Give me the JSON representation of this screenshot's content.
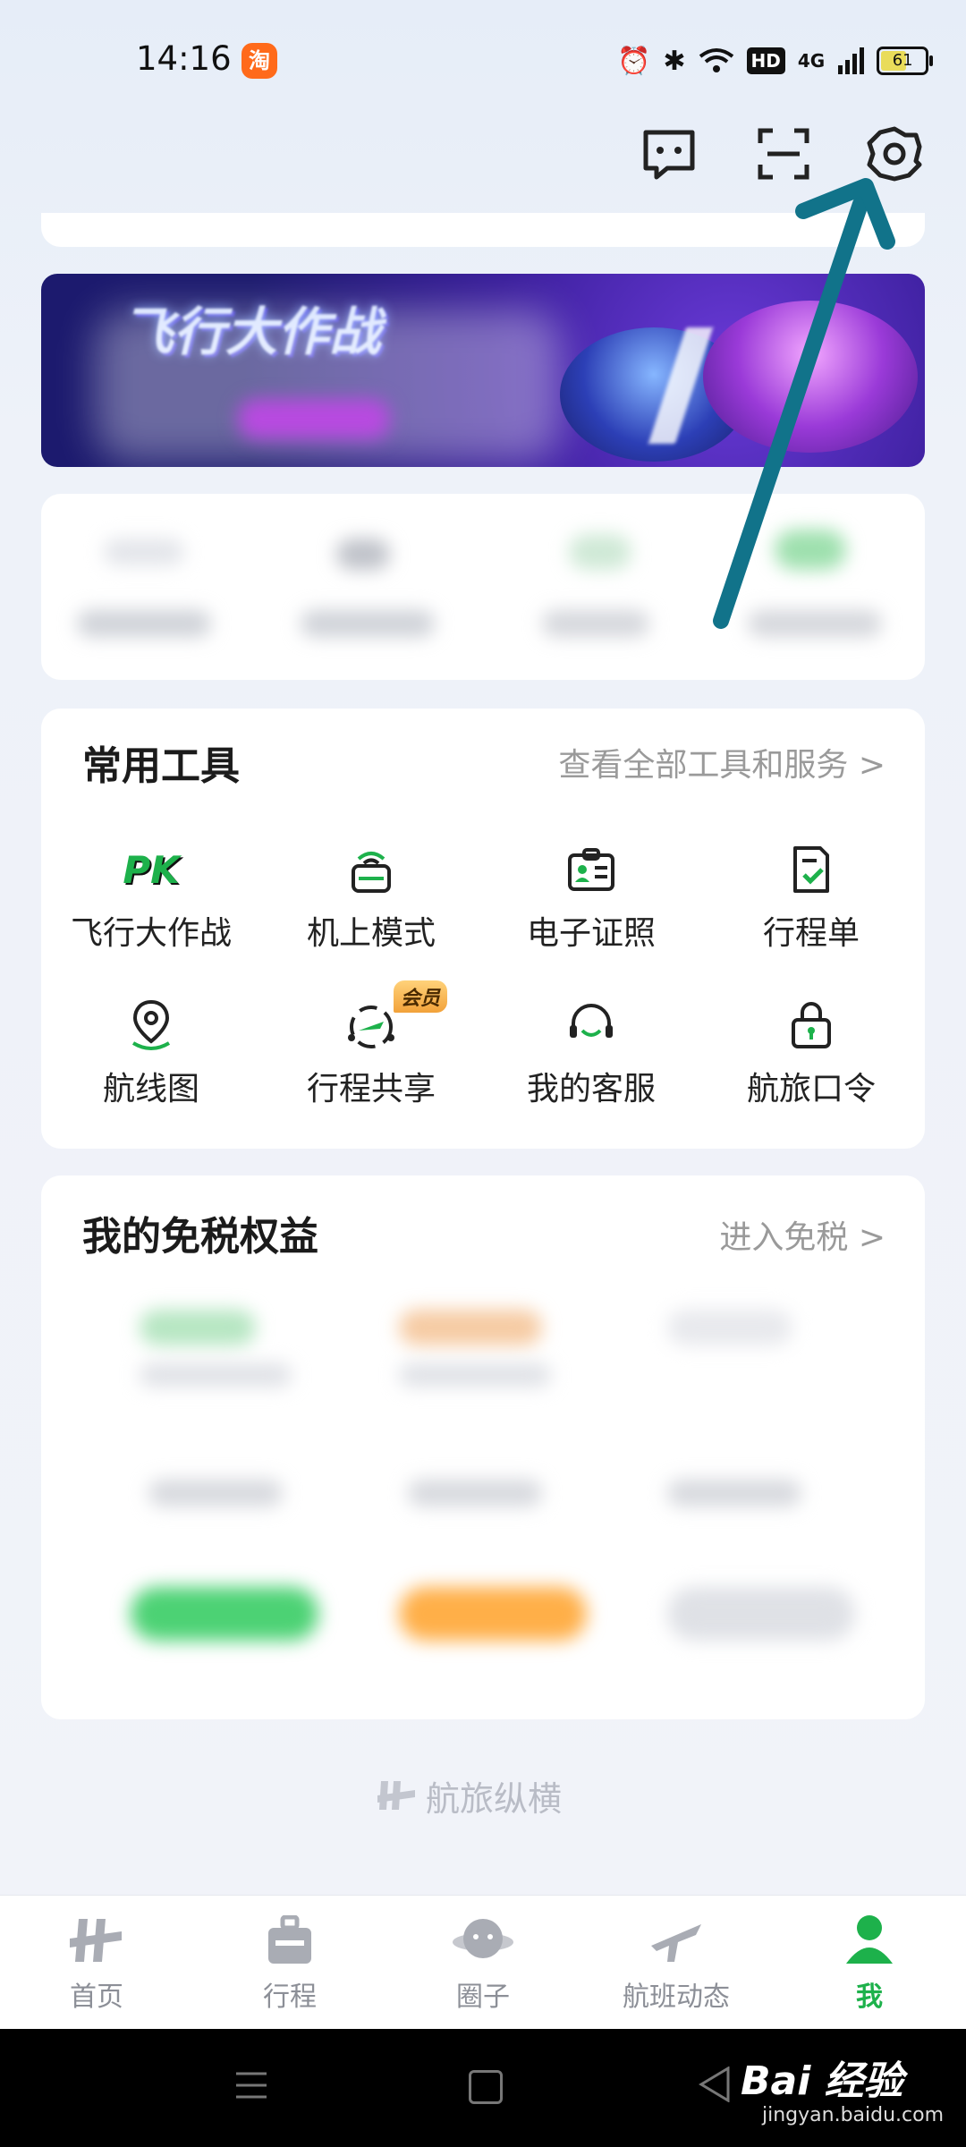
{
  "status_bar": {
    "time": "14:16",
    "taobao_badge": "淘",
    "network": "4G",
    "battery": "61"
  },
  "header": {
    "icons": [
      "message-icon",
      "scan-icon",
      "settings-icon"
    ]
  },
  "banner": {
    "title": "飞行大作战"
  },
  "tools": {
    "title": "常用工具",
    "link": "查看全部工具和服务 >",
    "items": [
      {
        "label": "飞行大作战",
        "icon": "pk-icon",
        "badge": "PK"
      },
      {
        "label": "机上模式",
        "icon": "wifi-box-icon"
      },
      {
        "label": "电子证照",
        "icon": "id-card-icon"
      },
      {
        "label": "行程单",
        "icon": "itinerary-icon"
      },
      {
        "label": "航线图",
        "icon": "map-pin-icon"
      },
      {
        "label": "行程共享",
        "icon": "share-trip-icon",
        "badge": "会员"
      },
      {
        "label": "我的客服",
        "icon": "headset-icon"
      },
      {
        "label": "航旅口令",
        "icon": "lock-icon"
      }
    ]
  },
  "duty_free": {
    "title": "我的免税权益",
    "link": "进入免税 >"
  },
  "brand": {
    "name": "航旅纵横"
  },
  "nav": {
    "items": [
      {
        "label": "首页",
        "icon": "home-icon"
      },
      {
        "label": "行程",
        "icon": "luggage-icon"
      },
      {
        "label": "圈子",
        "icon": "planet-icon"
      },
      {
        "label": "航班动态",
        "icon": "plane-icon"
      },
      {
        "label": "我",
        "icon": "person-icon",
        "active": true
      }
    ]
  },
  "watermark": {
    "text": "Bai 经验",
    "sub": "jingyan.baidu.com"
  },
  "colors": {
    "accent": "#1db14b",
    "arrow": "#11738a"
  }
}
